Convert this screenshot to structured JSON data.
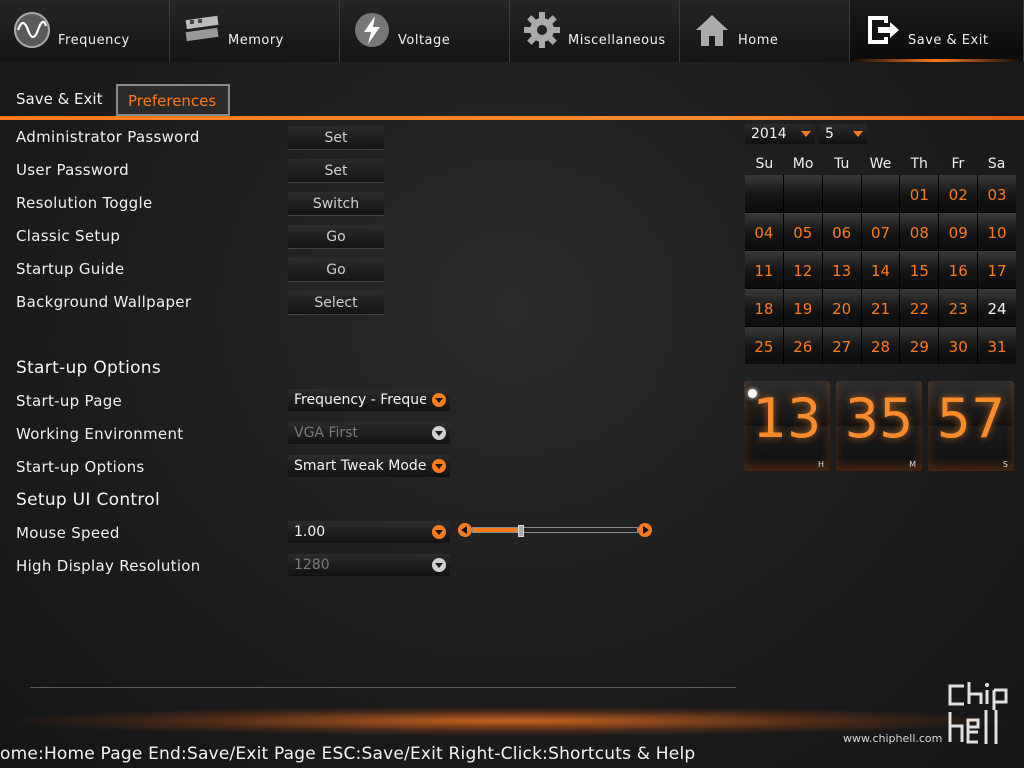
{
  "nav": {
    "tabs": [
      {
        "label": "Frequency",
        "icon": "frequency-icon"
      },
      {
        "label": "Memory",
        "icon": "memory-icon"
      },
      {
        "label": "Voltage",
        "icon": "voltage-icon"
      },
      {
        "label": "Miscellaneous",
        "icon": "gear-icon"
      },
      {
        "label": "Home",
        "icon": "home-icon"
      },
      {
        "label": "Save & Exit",
        "icon": "exit-icon",
        "active": true
      }
    ]
  },
  "subtabs": {
    "save_exit": "Save & Exit",
    "preferences": "Preferences"
  },
  "settings": {
    "admin_password": {
      "label": "Administrator Password",
      "button": "Set"
    },
    "user_password": {
      "label": "User Password",
      "button": "Set"
    },
    "resolution_toggle": {
      "label": "Resolution Toggle",
      "button": "Switch"
    },
    "classic_setup": {
      "label": "Classic Setup",
      "button": "Go"
    },
    "startup_guide": {
      "label": "Startup Guide",
      "button": "Go"
    },
    "background_wallpaper": {
      "label": "Background Wallpaper",
      "button": "Select"
    }
  },
  "startup": {
    "title": "Start-up Options",
    "page": {
      "label": "Start-up Page",
      "value": "Frequency - Frequency"
    },
    "environment": {
      "label": "Working Environment",
      "value": "VGA First"
    },
    "options": {
      "label": "Start-up Options",
      "value": "Smart Tweak Mode"
    }
  },
  "ui_control": {
    "title": "Setup UI Control",
    "mouse_speed": {
      "label": "Mouse Speed",
      "value": "1.00",
      "slider_fraction": 0.29
    },
    "display_res": {
      "label": "High Display Resolution",
      "value": "1280"
    }
  },
  "calendar": {
    "year": "2014",
    "month": "5",
    "weekdays": [
      "Su",
      "Mo",
      "Tu",
      "We",
      "Th",
      "Fr",
      "Sa"
    ],
    "cells": [
      "",
      "",
      "",
      "",
      "01",
      "02",
      "03",
      "04",
      "05",
      "06",
      "07",
      "08",
      "09",
      "10",
      "11",
      "12",
      "13",
      "14",
      "15",
      "16",
      "17",
      "18",
      "19",
      "20",
      "21",
      "22",
      "23",
      "24",
      "25",
      "26",
      "27",
      "28",
      "29",
      "30",
      "31"
    ],
    "today": "24"
  },
  "clock": {
    "hours": "13",
    "minutes": "35",
    "seconds": "57",
    "h_label": "H",
    "m_label": "M",
    "s_label": "S"
  },
  "footer": {
    "help": "ome:Home Page End:Save/Exit Page ESC:Save/Exit Right-Click:Shortcuts & Help",
    "site": "www.chiphell.com",
    "logo_text": "chip hell"
  },
  "colors": {
    "accent": "#ff7a1a",
    "background": "#1c1c1c"
  }
}
